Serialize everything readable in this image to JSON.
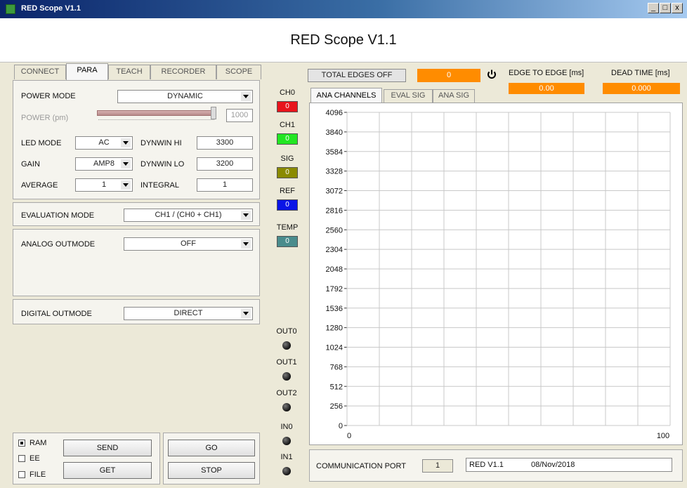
{
  "window": {
    "title": "RED Scope V1.1",
    "minimize": "_",
    "maximize": "□",
    "close": "x"
  },
  "app_title": "RED Scope V1.1",
  "tabs": [
    "CONNECT",
    "PARA",
    "TEACH",
    "RECORDER",
    "SCOPE"
  ],
  "active_tab": "PARA",
  "para": {
    "power_mode_label": "POWER MODE",
    "power_mode_value": "DYNAMIC",
    "power_label": "POWER (pm)",
    "power_value": "1000",
    "led_mode_label": "LED MODE",
    "led_mode_value": "AC",
    "dynwin_hi_label": "DYNWIN HI",
    "dynwin_hi_value": "3300",
    "gain_label": "GAIN",
    "gain_value": "AMP8",
    "dynwin_lo_label": "DYNWIN LO",
    "dynwin_lo_value": "3200",
    "average_label": "AVERAGE",
    "average_value": "1",
    "integral_label": "INTEGRAL",
    "integral_value": "1",
    "evaluation_mode_label": "EVALUATION MODE",
    "evaluation_mode_value": "CH1 / (CH0 + CH1)",
    "analog_outmode_label": "ANALOG OUTMODE",
    "analog_outmode_value": "OFF",
    "digital_outmode_label": "DIGITAL OUTMODE",
    "digital_outmode_value": "DIRECT"
  },
  "bottom": {
    "ram": "RAM",
    "ee": "EE",
    "file": "FILE",
    "send": "SEND",
    "get": "GET",
    "go": "GO",
    "stop": "STOP"
  },
  "channels": [
    {
      "label": "CH0",
      "value": "0",
      "color": "#e8141c"
    },
    {
      "label": "CH1",
      "value": "0",
      "color": "#22e622"
    },
    {
      "label": "SIG",
      "value": "0",
      "color": "#8a8a00"
    },
    {
      "label": "REF",
      "value": "0",
      "color": "#0a14e6"
    },
    {
      "label": "TEMP",
      "value": "0",
      "color": "#4a8c8c"
    }
  ],
  "io": [
    "OUT0",
    "OUT1",
    "OUT2",
    "IN0",
    "IN1"
  ],
  "scope_header": {
    "total_edges": "TOTAL EDGES OFF",
    "total_edges_value": "0",
    "edge_to_edge_label": "EDGE TO EDGE [ms]",
    "edge_to_edge_value": "0.00",
    "dead_time_label": "DEAD TIME [ms]",
    "dead_time_value": "0.000"
  },
  "chart_tabs": [
    "ANA CHANNELS",
    "EVAL SIG",
    "ANA SIG"
  ],
  "chart_data": {
    "type": "line",
    "yticks": [
      "4096",
      "3840",
      "3584",
      "3328",
      "3072",
      "2816",
      "2560",
      "2304",
      "2048",
      "1792",
      "1536",
      "1280",
      "1024",
      "768",
      "512",
      "256",
      "0"
    ],
    "xticks": [
      "0",
      "100"
    ],
    "ylim": [
      0,
      4096
    ],
    "xlim": [
      0,
      100
    ],
    "grid": true,
    "series": []
  },
  "footer": {
    "comm_port_label": "COMMUNICATION PORT",
    "comm_port_value": "1",
    "version": "RED V1.1",
    "date": "08/Nov/2018"
  },
  "colors": {
    "orange": "#ff8c00",
    "panel": "#ece9d8"
  }
}
